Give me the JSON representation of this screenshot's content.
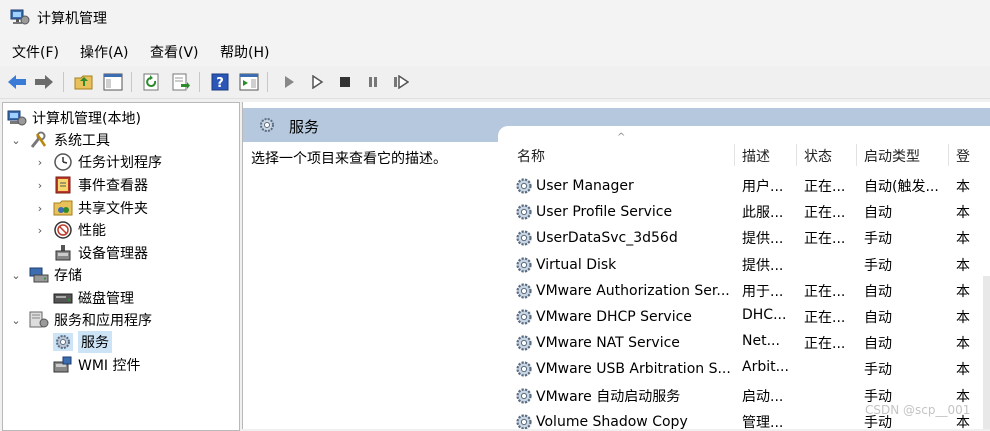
{
  "window": {
    "title": "计算机管理"
  },
  "menu": [
    {
      "label": "文件(F)"
    },
    {
      "label": "操作(A)"
    },
    {
      "label": "查看(V)"
    },
    {
      "label": "帮助(H)"
    }
  ],
  "toolbar": {
    "icons": [
      "back-arrow-icon",
      "forward-arrow-icon",
      "up-folder-icon",
      "show-hide-tree-icon",
      "refresh-icon",
      "export-list-icon",
      "help-icon",
      "action-pane-icon",
      "start-service-icon",
      "start-icon",
      "stop-service-icon",
      "pause-service-icon",
      "restart-service-icon"
    ]
  },
  "tree": {
    "root": "计算机管理(本地)",
    "items": [
      {
        "label": "系统工具",
        "expander": "⌄"
      },
      {
        "label": "任务计划程序",
        "expander": "›"
      },
      {
        "label": "事件查看器",
        "expander": "›"
      },
      {
        "label": "共享文件夹",
        "expander": "›"
      },
      {
        "label": "性能",
        "expander": "›"
      },
      {
        "label": "设备管理器",
        "expander": ""
      },
      {
        "label": "存储",
        "expander": "⌄"
      },
      {
        "label": "磁盘管理",
        "expander": ""
      },
      {
        "label": "服务和应用程序",
        "expander": "⌄"
      },
      {
        "label": "服务",
        "expander": ""
      },
      {
        "label": "WMI 控件",
        "expander": ""
      }
    ]
  },
  "services": {
    "header": "服务",
    "description_hint": "选择一个项目来查看它的描述。",
    "columns": [
      "名称",
      "描述",
      "状态",
      "启动类型",
      "登"
    ],
    "rows": [
      {
        "name": "User Manager",
        "desc": "用户...",
        "status": "正在...",
        "startup": "自动(触发...",
        "logon": "本"
      },
      {
        "name": "User Profile Service",
        "desc": "此服...",
        "status": "正在...",
        "startup": "自动",
        "logon": "本"
      },
      {
        "name": "UserDataSvc_3d56d",
        "desc": "提供...",
        "status": "正在...",
        "startup": "手动",
        "logon": "本"
      },
      {
        "name": "Virtual Disk",
        "desc": "提供...",
        "status": "",
        "startup": "手动",
        "logon": "本"
      },
      {
        "name": "VMware Authorization Ser...",
        "desc": "用于...",
        "status": "正在...",
        "startup": "自动",
        "logon": "本"
      },
      {
        "name": "VMware DHCP Service",
        "desc": "DHC...",
        "status": "正在...",
        "startup": "自动",
        "logon": "本"
      },
      {
        "name": "VMware NAT Service",
        "desc": "Net...",
        "status": "正在...",
        "startup": "自动",
        "logon": "本"
      },
      {
        "name": "VMware USB Arbitration S...",
        "desc": "Arbit...",
        "status": "",
        "startup": "手动",
        "logon": "本"
      },
      {
        "name": "VMware 自动启动服务",
        "desc": "启动...",
        "status": "",
        "startup": "手动",
        "logon": "本"
      },
      {
        "name": "Volume Shadow Copy",
        "desc": "管理...",
        "status": "",
        "startup": "手动",
        "logon": "本"
      }
    ]
  },
  "watermark": "CSDN @scp__001"
}
